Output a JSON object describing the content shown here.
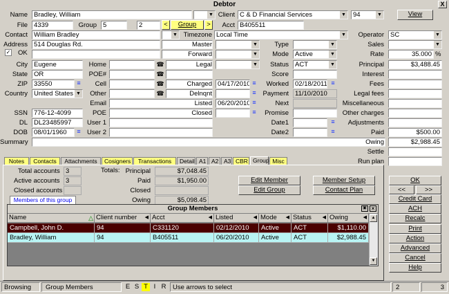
{
  "window": {
    "title": "Debtor",
    "close": "X"
  },
  "debtor": {
    "name_label": "Name",
    "name": "Bradley, William",
    "file_label": "File",
    "file": "4339",
    "group_label": "Group",
    "group_num": "5",
    "group_sub": "2",
    "group_nav_prev": "<",
    "group_nav_label": "Group",
    "group_nav_next": ">",
    "contact_label": "Contact",
    "contact": "William Bradley",
    "address_label": "Address",
    "address": "514 Douglas Rd.",
    "ok_check": "✓",
    "ok_label": "OK",
    "city_label": "City",
    "city": "Eugene",
    "state_label": "State",
    "state": "OR",
    "zip_label": "ZIP",
    "zip": "33550",
    "country_label": "Country",
    "country": "United States",
    "ssn_label": "SSN",
    "ssn": "776-12-4099",
    "dl_label": "DL",
    "dl": "DL23485997",
    "dob_label": "DOB",
    "dob": "08/01/1960",
    "summary_label": "Summary",
    "home_label": "Home",
    "poe_num_label": "POE#",
    "cell_label": "Cell",
    "other_label": "Other",
    "email_label": "Email",
    "poe_label": "POE",
    "user1_label": "User 1",
    "user2_label": "User 2"
  },
  "client": {
    "client_label": "Client",
    "client": "C & D Financial Services",
    "client_code": "94",
    "view_button": "View",
    "acct_label": "Acct",
    "acct": "B405511",
    "timezone_label": "Timezone",
    "timezone": "Local Time",
    "master_label": "Master",
    "forward_label": "Forward",
    "legal_label": "Legal",
    "charged_label": "Charged",
    "charged": "04/17/2010",
    "delnqnt_label": "Delnqnt",
    "listed_label": "Listed",
    "listed": "06/20/2010",
    "closed_label": "Closed",
    "type_label": "Type",
    "mode_label": "Mode",
    "mode": "Active",
    "status_label": "Status",
    "status": "ACT",
    "score_label": "Score",
    "worked_label": "Worked",
    "worked": "02/18/2011",
    "payment_label": "Payment",
    "payment": "11/10/2010",
    "next_label": "Next",
    "promise_label": "Promise",
    "date1_label": "Date1",
    "date2_label": "Date2"
  },
  "financial": {
    "operator_label": "Operator",
    "operator": "SC",
    "sales_label": "Sales",
    "rate_label": "Rate",
    "rate": "35.000",
    "rate_unit": "%",
    "principal_label": "Principal",
    "principal": "$3,488.45",
    "interest_label": "Interest",
    "fees_label": "Fees",
    "legal_fees_label": "Legal fees",
    "misc_label": "Miscellaneous",
    "other_charges_label": "Other charges",
    "adjustments_label": "Adjustments",
    "paid_label": "Paid",
    "paid": "$500.00",
    "owing_label": "Owing",
    "owing": "$2,988.45",
    "settle_label": "Settle",
    "run_plan_label": "Run plan"
  },
  "tabs": [
    "Notes",
    "Contacts",
    "Attachments",
    "Cosigners",
    "Transactions",
    "Detail",
    "A1",
    "A2",
    "A3",
    "CBR",
    "Group",
    "Misc"
  ],
  "group_panel": {
    "total_accounts_label": "Total accounts",
    "total_accounts": "3",
    "active_accounts_label": "Active accounts",
    "active_accounts": "3",
    "closed_accounts_label": "Closed accounts",
    "closed_accounts": "",
    "totals_label": "Totals:",
    "principal_label": "Principal",
    "principal": "$7,048.45",
    "paid_label": "Paid",
    "paid": "$1,950.00",
    "closed_label": "Closed",
    "closed": "",
    "owing_label": "Owing",
    "owing": "$5,098.45",
    "edit_member": "Edit Member",
    "edit_group": "Edit Group",
    "member_setup": "Member Setup",
    "contact_plan": "Contact Plan",
    "subtab": "Members of this group"
  },
  "members_grid": {
    "title": "Group Members",
    "columns": [
      "Name",
      "Client number",
      "Acct",
      "Listed",
      "Mode",
      "Status",
      "Owing"
    ],
    "rows": [
      [
        "Campbell, John D.",
        "94",
        "C331120",
        "02/12/2010",
        "Active",
        "ACT",
        "$1,110.00"
      ],
      [
        "Bradley, William",
        "94",
        "B405511",
        "06/20/2010",
        "Active",
        "ACT",
        "$2,988.45"
      ]
    ]
  },
  "side_buttons": {
    "ok": "OK",
    "prev": "<<",
    "next": ">>",
    "items": [
      "Credit Card",
      "ACH",
      "Recalc",
      "Print",
      "Action",
      "Advanced",
      "Cancel",
      "Help"
    ]
  },
  "statusbar": {
    "mode": "Browsing",
    "context": "Group Members",
    "keys": [
      "E",
      "S",
      "T",
      "I",
      "R"
    ],
    "hint": "Use arrows to select",
    "num1": "2",
    "num2": "3"
  }
}
